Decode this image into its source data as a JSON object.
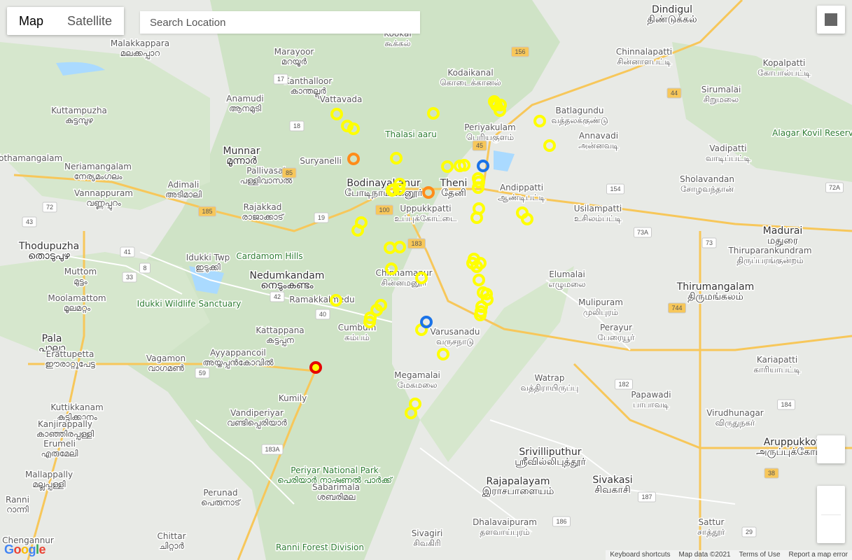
{
  "map_type": {
    "map_label": "Map",
    "satellite_label": "Satellite",
    "active": "Map"
  },
  "search": {
    "placeholder": "Search Location"
  },
  "footer": {
    "keyboard_shortcuts": "Keyboard shortcuts",
    "map_data": "Map data ©2021",
    "terms": "Terms of Use",
    "report": "Report a map error"
  },
  "logo": "Google",
  "colors": {
    "land": "#e8eae6",
    "green_hills": "#c9dfc0",
    "water": "#aadaff",
    "highway": "#f7c75a",
    "road": "#ffffff",
    "marker_yellow": "#ffff00",
    "marker_orange": "#ff8c1a",
    "marker_blue": "#1a73e8",
    "marker_red": "#e50000"
  },
  "places": [
    {
      "name": "Dindigul",
      "local": "திண்டுக்கல்",
      "big": true
    },
    {
      "name": "Chinnalapatti",
      "local": "சின்னாளபட்டி"
    },
    {
      "name": "Kookal",
      "local": "கூக்கல்"
    },
    {
      "name": "Kodaikanal",
      "local": "கொடைக்கானல்"
    },
    {
      "name": "Malakkappara",
      "local": "മലക്കപ്പാറ"
    },
    {
      "name": "Marayoor",
      "local": "മറയൂർ"
    },
    {
      "name": "Kanthalloor",
      "local": "കാന്തല്ലൂർ"
    },
    {
      "name": "Anamudi",
      "local": "ആനമുടി"
    },
    {
      "name": "Vattavada",
      "local": ""
    },
    {
      "name": "Kuttampuzha",
      "local": "കുട്ടമ്പുഴ"
    },
    {
      "name": "Munnar",
      "local": "മൂന്നാർ",
      "big": true
    },
    {
      "name": "Thalasi aaru",
      "local": "",
      "park": true
    },
    {
      "name": "Periyakulam",
      "local": "பெரியகுளம்"
    },
    {
      "name": "Batlagundu",
      "local": "வத்தலக்குண்டு"
    },
    {
      "name": "Kothamangalam",
      "local": ""
    },
    {
      "name": "Neriamangalam",
      "local": "നേര്യമംഗലം"
    },
    {
      "name": "Suryanelli",
      "local": ""
    },
    {
      "name": "Pallivasal",
      "local": "പള്ളിവാസൽ"
    },
    {
      "name": "Adimali",
      "local": "അടിമാലി"
    },
    {
      "name": "Vannappuram",
      "local": "വണ്ണപ്പുറം"
    },
    {
      "name": "Bodinayakanur",
      "local": "போடிநாயக்கனூர்",
      "big": true
    },
    {
      "name": "Theni",
      "local": "தேனி",
      "big": true
    },
    {
      "name": "Andippatti",
      "local": "ஆண்டிபட்டி"
    },
    {
      "name": "Annavadi",
      "local": "அன்னவடி"
    },
    {
      "name": "Sirumalai",
      "local": "சிறுமலை"
    },
    {
      "name": "Kopalpatti",
      "local": "கோபால்பட்டி"
    },
    {
      "name": "Vadipatti",
      "local": "வாடிப்பட்டி"
    },
    {
      "name": "Sholavandan",
      "local": "சோழவந்தான்"
    },
    {
      "name": "Alagar Kovil Reserve Forest",
      "local": "",
      "park": true
    },
    {
      "name": "Thodupuzha",
      "local": "തൊടുപുഴ",
      "big": true
    },
    {
      "name": "Rajakkad",
      "local": "രാജാക്കാട്"
    },
    {
      "name": "Uppukkpatti",
      "local": "உப்புக்கோட்டை"
    },
    {
      "name": "Usilampatti",
      "local": "உசிலம்பட்டி"
    },
    {
      "name": "Madurai",
      "local": "மதுரை",
      "big": true
    },
    {
      "name": "Cardamom Hills",
      "local": "",
      "park": true
    },
    {
      "name": "Idukki Twp",
      "local": "ഇടുക്കി"
    },
    {
      "name": "Muttom",
      "local": "മുട്ടം"
    },
    {
      "name": "Nedumkandam",
      "local": "നെടുംകണ്ടം",
      "big": true
    },
    {
      "name": "Chinnamanur",
      "local": "சின்னமனூர்"
    },
    {
      "name": "Elumalai",
      "local": "எழுமலை"
    },
    {
      "name": "Thiruparankundram",
      "local": "திருப்பரங்குன்றம்"
    },
    {
      "name": "Moolamattom",
      "local": "മൂലമറ്റം"
    },
    {
      "name": "Idukki Wildlife Sanctuary",
      "local": "",
      "park": true
    },
    {
      "name": "Ramakkalmedu",
      "local": ""
    },
    {
      "name": "Kattappana",
      "local": "കട്ടപ്പന"
    },
    {
      "name": "Cumbum",
      "local": "கம்பம்"
    },
    {
      "name": "Varusanadu",
      "local": "வருசநாடு"
    },
    {
      "name": "Mulipuram",
      "local": "முலிபுரம்"
    },
    {
      "name": "Thirumangalam",
      "local": "திருமங்கலம்",
      "big": true
    },
    {
      "name": "Pala",
      "local": "പാലാ",
      "big": true
    },
    {
      "name": "Erattupetta",
      "local": "ഈരാറ്റുപേട്ട"
    },
    {
      "name": "Vagamon",
      "local": "വാഗമൺ"
    },
    {
      "name": "Ayyappancoil",
      "local": "അയ്യപ്പൻകോവിൽ"
    },
    {
      "name": "Perayur",
      "local": "பேரையூர்"
    },
    {
      "name": "Kariapatti",
      "local": "காரியாபட்டி"
    },
    {
      "name": "Megamalai",
      "local": "மேகமலை"
    },
    {
      "name": "Watrap",
      "local": "வத்திராயிருப்பு"
    },
    {
      "name": "Kuttikkanam",
      "local": "കുട്ടിക്കാനം"
    },
    {
      "name": "Kumily",
      "local": ""
    },
    {
      "name": "Vandiperiyar",
      "local": "വണ്ടിപ്പെരിയാർ"
    },
    {
      "name": "Kanjirappally",
      "local": "കാഞ്ഞിരപ്പള്ളി"
    },
    {
      "name": "Papawadi",
      "local": "பாபாவடி"
    },
    {
      "name": "Virudhunagar",
      "local": "விருதுநகர்"
    },
    {
      "name": "Aruppukkottai",
      "local": "அருப்புக்கோட்டை",
      "big": true
    },
    {
      "name": "Periyar National Park",
      "local": "പെരിയാർ നാഷണൽ പാർക്ക്",
      "park": true
    },
    {
      "name": "Srivilliputhur",
      "local": "ஸ்ரீவில்லிபுத்தூர்",
      "big": true
    },
    {
      "name": "Erumeli",
      "local": "എരുമേലി"
    },
    {
      "name": "Mallappally",
      "local": "മല്ലപ്പള്ളി"
    },
    {
      "name": "Rajapalayam",
      "local": "இராசபாளையம்",
      "big": true
    },
    {
      "name": "Sivakasi",
      "local": "சிவகாசி",
      "big": true
    },
    {
      "name": "Sabarimala",
      "local": "ശബരിമല"
    },
    {
      "name": "Perunad",
      "local": "പെരുനാട്"
    },
    {
      "name": "Ranni",
      "local": "റാന്നി"
    },
    {
      "name": "Dhalavaipuram",
      "local": "தளவாய்புரம்"
    },
    {
      "name": "Sattur",
      "local": "சாத்தூர்"
    },
    {
      "name": "Chittar",
      "local": "ചിറ്റാർ"
    },
    {
      "name": "Ranni Forest Division",
      "local": "",
      "park": true
    },
    {
      "name": "Sivagiri",
      "local": "சிவகிரி"
    },
    {
      "name": "Chengannur",
      "local": ""
    }
  ],
  "road_shields": [
    "156",
    "45",
    "44",
    "17",
    "18",
    "85",
    "185",
    "19",
    "100",
    "183",
    "154",
    "72A",
    "72",
    "43",
    "8",
    "41",
    "33",
    "42",
    "40",
    "73A",
    "73",
    "744",
    "182",
    "184",
    "59",
    "183A",
    "186",
    "187",
    "38",
    "29"
  ],
  "markers": {
    "yellow_count": 52,
    "orange_count": 2,
    "blue_count": 2,
    "red_count": 1
  }
}
